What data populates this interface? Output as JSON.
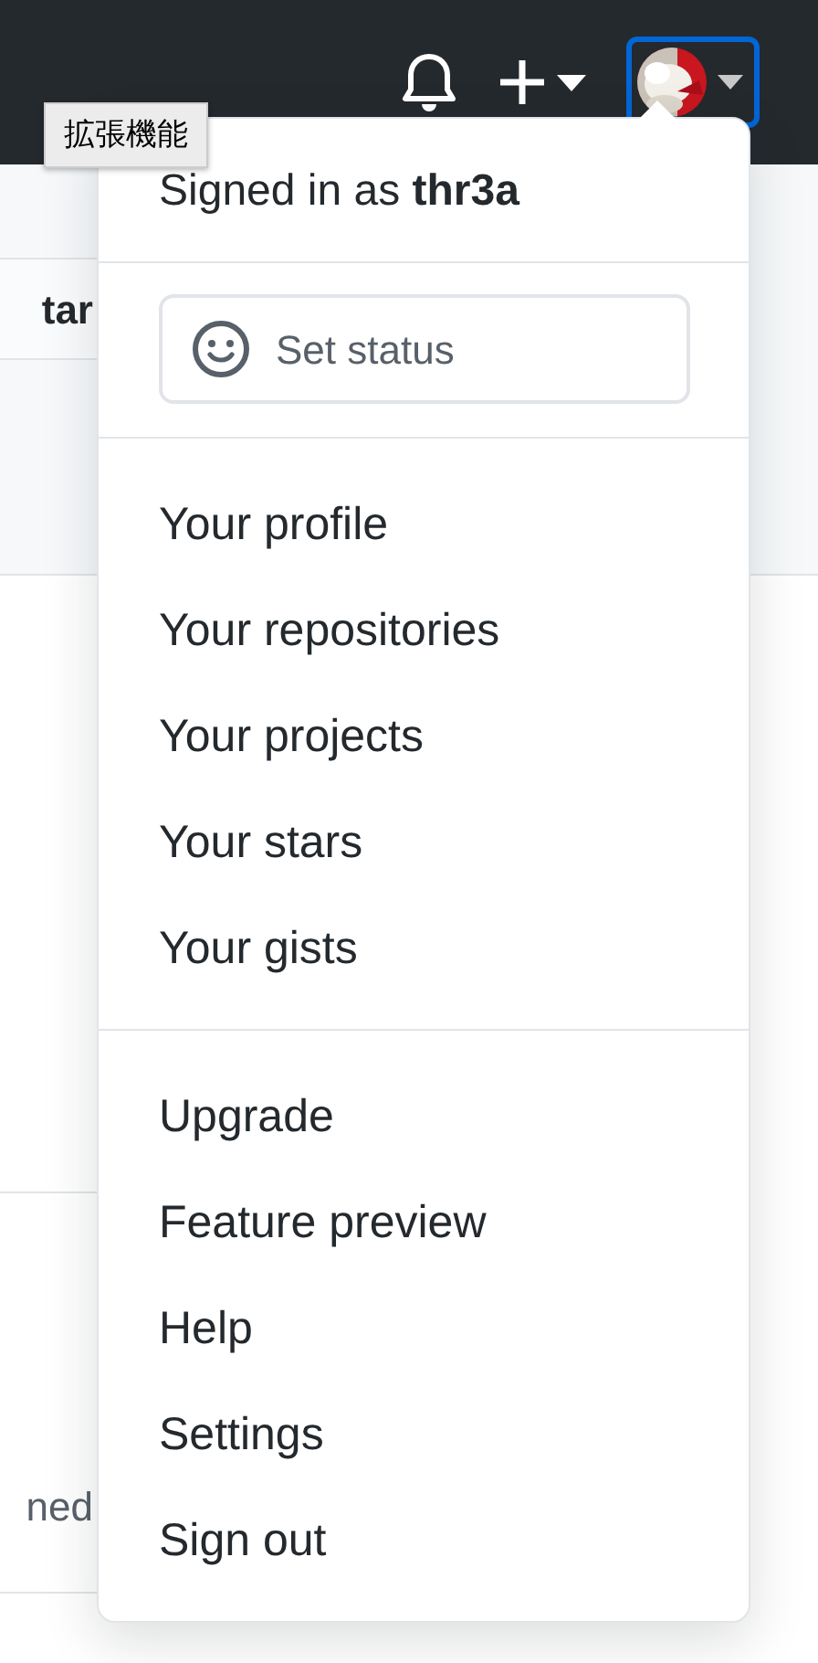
{
  "header": {
    "tooltip": "拡張機能"
  },
  "background": {
    "cut_texts": [
      "tar",
      "ned"
    ]
  },
  "menu": {
    "signed_in_prefix": "Signed in as",
    "username": "thr3a",
    "status_button": "Set status",
    "sections": [
      {
        "items": [
          "Your profile",
          "Your repositories",
          "Your projects",
          "Your stars",
          "Your gists"
        ]
      },
      {
        "items": [
          "Upgrade",
          "Feature preview",
          "Help",
          "Settings",
          "Sign out"
        ]
      }
    ]
  }
}
